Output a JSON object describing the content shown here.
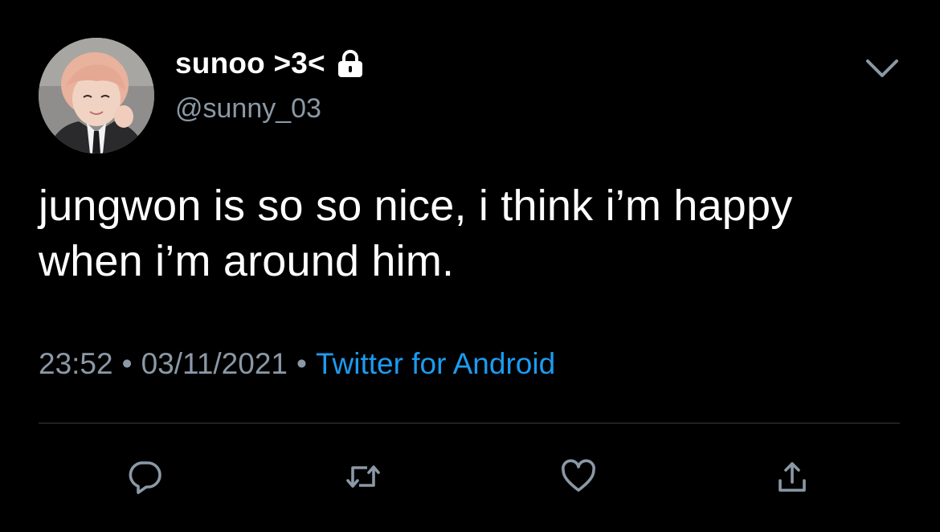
{
  "tweet": {
    "author": {
      "display_name": "sunoo >3<",
      "handle": "@sunny_03",
      "protected": true
    },
    "text_lines": [
      "jungwon is so so nice, i think i’m happy",
      "when i’m around him."
    ],
    "meta": {
      "time": "23:52",
      "date": "03/11/2021",
      "separator": "•",
      "source": "Twitter for Android"
    },
    "actions": [
      "reply-icon",
      "retweet-icon",
      "like-icon",
      "share-icon"
    ],
    "colors": {
      "background": "#000000",
      "text": "#ffffff",
      "secondary": "#8b98a5",
      "accent": "#1d9bf0",
      "icon": "#8b98a5"
    }
  }
}
